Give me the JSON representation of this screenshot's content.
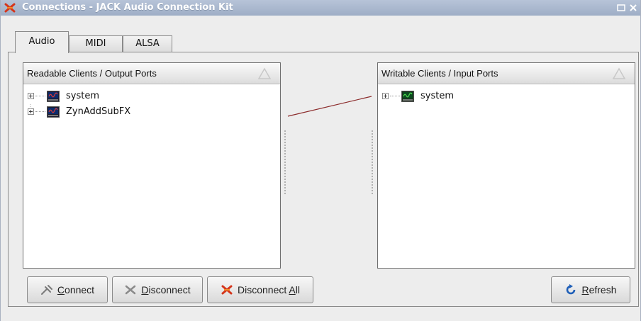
{
  "window": {
    "title": "Connections - JACK Audio Connection Kit"
  },
  "tabs": [
    {
      "label": "Audio",
      "active": true
    },
    {
      "label": "MIDI",
      "active": false
    },
    {
      "label": "ALSA",
      "active": false
    }
  ],
  "readable": {
    "header": "Readable Clients / Output Ports",
    "clients": [
      {
        "label": "system",
        "icon": "client-icon"
      },
      {
        "label": "ZynAddSubFX",
        "icon": "client-icon"
      }
    ]
  },
  "writable": {
    "header": "Writable Clients / Input Ports",
    "clients": [
      {
        "label": "system",
        "icon": "client-icon"
      }
    ]
  },
  "buttons": {
    "connect": {
      "mnemonic": "C",
      "rest": "onnect"
    },
    "disconnect": {
      "mnemonic": "D",
      "rest": "isconnect"
    },
    "disconnect_all": {
      "pre": "Disconnect ",
      "mnemonic": "A",
      "rest": "ll"
    },
    "refresh": {
      "mnemonic": "R",
      "rest": "efresh"
    }
  },
  "colors": {
    "titlebar": "#a9b7cc",
    "connection_line": "#8b2a2a",
    "accent_red": "#c0392b",
    "refresh_blue": "#1f5fb8"
  }
}
